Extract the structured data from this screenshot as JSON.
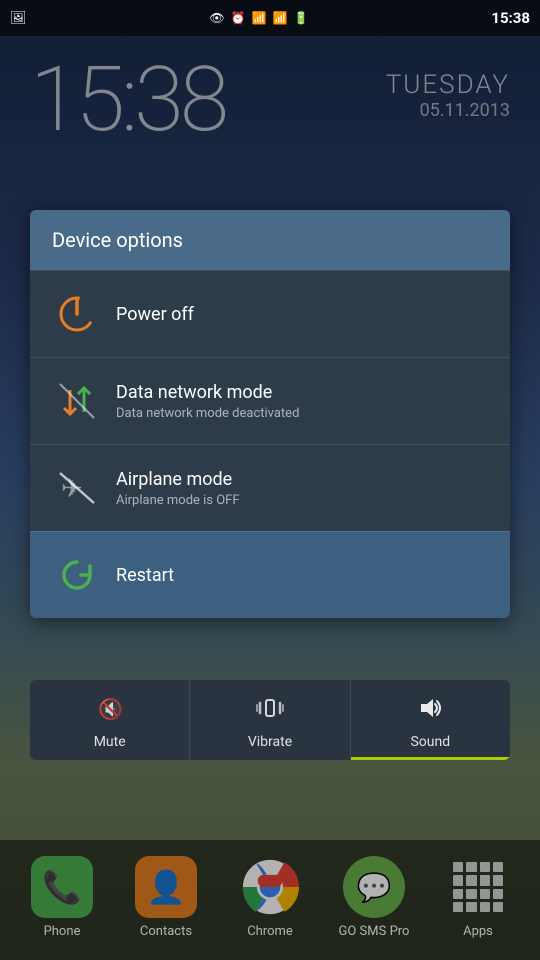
{
  "statusBar": {
    "time": "15:38",
    "icons": [
      "📷",
      "👁",
      "⏰",
      "📶",
      "📶",
      "🔋"
    ]
  },
  "wallpaper": {
    "time": "15:38",
    "day": "TUESDAY",
    "date": "05.11.2013"
  },
  "dialog": {
    "title": "Device options",
    "items": [
      {
        "id": "power-off",
        "label": "Power off",
        "subtitle": "",
        "icon": "power"
      },
      {
        "id": "data-network",
        "label": "Data network mode",
        "subtitle": "Data network mode deactivated",
        "icon": "data"
      },
      {
        "id": "airplane",
        "label": "Airplane mode",
        "subtitle": "Airplane mode is OFF",
        "icon": "airplane"
      },
      {
        "id": "restart",
        "label": "Restart",
        "subtitle": "",
        "icon": "restart"
      }
    ]
  },
  "soundModes": {
    "items": [
      {
        "id": "mute",
        "label": "Mute",
        "active": false
      },
      {
        "id": "vibrate",
        "label": "Vibrate",
        "active": false
      },
      {
        "id": "sound",
        "label": "Sound",
        "active": true
      }
    ]
  },
  "dock": {
    "items": [
      {
        "id": "phone",
        "label": "Phone"
      },
      {
        "id": "contacts",
        "label": "Contacts"
      },
      {
        "id": "chrome",
        "label": "Chrome"
      },
      {
        "id": "gosms",
        "label": "GO SMS Pro"
      },
      {
        "id": "apps",
        "label": "Apps"
      }
    ]
  }
}
